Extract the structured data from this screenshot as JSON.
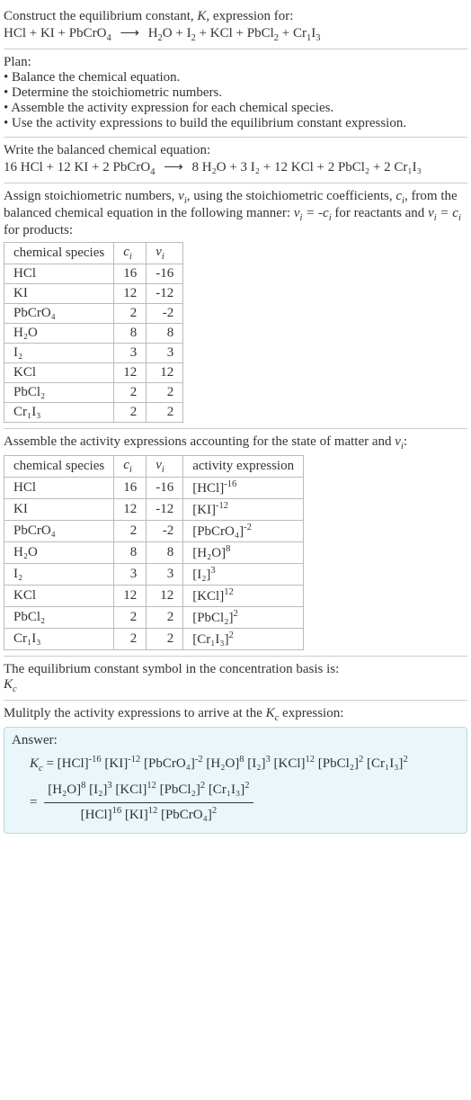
{
  "intro": {
    "line1_pre": "Construct the equilibrium constant, ",
    "line1_K": "K",
    "line1_post": ", expression for:",
    "eq_lhs": "HCl + KI + PbCrO",
    "eq_lhs_sub": "4",
    "arrow": "⟶",
    "eq_rhs_parts": [
      "H",
      "2",
      "O + I",
      "2",
      " + KCl + PbCl",
      "2",
      " + Cr",
      "1",
      "I",
      "3"
    ]
  },
  "plan": {
    "title": "Plan:",
    "items": [
      "Balance the chemical equation.",
      "Determine the stoichiometric numbers.",
      "Assemble the activity expression for each chemical species.",
      "Use the activity expressions to build the equilibrium constant expression."
    ]
  },
  "balanced": {
    "title": "Write the balanced chemical equation:",
    "lhs": "16 HCl + 12 KI + 2 PbCrO",
    "lhs_sub": "4",
    "arrow": "⟶",
    "rhs": "8 H₂O + 3 I₂ + 12 KCl + 2 PbCl₂ + 2 Cr₁I₃"
  },
  "assign": {
    "text_pre": "Assign stoichiometric numbers, ",
    "nu": "ν",
    "i": "i",
    "text_mid1": ", using the stoichiometric coefficients, ",
    "c": "c",
    "text_mid2": ", from the balanced chemical equation in the following manner: ",
    "rel1": "ν_i = -c_i",
    "text_mid3": " for reactants and ",
    "rel2": "ν_i = c_i",
    "text_end": " for products:"
  },
  "table1": {
    "headers": [
      "chemical species",
      "c_i",
      "ν_i"
    ],
    "rows": [
      [
        "HCl",
        "16",
        "-16"
      ],
      [
        "KI",
        "12",
        "-12"
      ],
      [
        "PbCrO₄",
        "2",
        "-2"
      ],
      [
        "H₂O",
        "8",
        "8"
      ],
      [
        "I₂",
        "3",
        "3"
      ],
      [
        "KCl",
        "12",
        "12"
      ],
      [
        "PbCl₂",
        "2",
        "2"
      ],
      [
        "Cr₁I₃",
        "2",
        "2"
      ]
    ]
  },
  "assemble_text": "Assemble the activity expressions accounting for the state of matter and ν_i:",
  "table2": {
    "headers": [
      "chemical species",
      "c_i",
      "ν_i",
      "activity expression"
    ],
    "rows": [
      {
        "sp": "HCl",
        "c": "16",
        "n": "-16",
        "ae_base": "[HCl]",
        "ae_exp": "-16"
      },
      {
        "sp": "KI",
        "c": "12",
        "n": "-12",
        "ae_base": "[KI]",
        "ae_exp": "-12"
      },
      {
        "sp": "PbCrO₄",
        "c": "2",
        "n": "-2",
        "ae_base": "[PbCrO₄]",
        "ae_exp": "-2"
      },
      {
        "sp": "H₂O",
        "c": "8",
        "n": "8",
        "ae_base": "[H₂O]",
        "ae_exp": "8"
      },
      {
        "sp": "I₂",
        "c": "3",
        "n": "3",
        "ae_base": "[I₂]",
        "ae_exp": "3"
      },
      {
        "sp": "KCl",
        "c": "12",
        "n": "12",
        "ae_base": "[KCl]",
        "ae_exp": "12"
      },
      {
        "sp": "PbCl₂",
        "c": "2",
        "n": "2",
        "ae_base": "[PbCl₂]",
        "ae_exp": "2"
      },
      {
        "sp": "Cr₁I₃",
        "c": "2",
        "n": "2",
        "ae_base": "[Cr₁I₃]",
        "ae_exp": "2"
      }
    ]
  },
  "symbol_text": "The equilibrium constant symbol in the concentration basis is:",
  "symbol": "K_c",
  "multiply_text": "Mulitply the activity expressions to arrive at the K_c expression:",
  "answer": {
    "label": "Answer:",
    "kc": "K_c",
    "line1_terms": [
      {
        "b": "[HCl]",
        "e": "-16"
      },
      {
        "b": "[KI]",
        "e": "-12"
      },
      {
        "b": "[PbCrO₄]",
        "e": "-2"
      },
      {
        "b": "[H₂O]",
        "e": "8"
      },
      {
        "b": "[I₂]",
        "e": "3"
      },
      {
        "b": "[KCl]",
        "e": "12"
      },
      {
        "b": "[PbCl₂]",
        "e": "2"
      },
      {
        "b": "[Cr₁I₃]",
        "e": "2"
      }
    ],
    "frac_num": [
      {
        "b": "[H₂O]",
        "e": "8"
      },
      {
        "b": "[I₂]",
        "e": "3"
      },
      {
        "b": "[KCl]",
        "e": "12"
      },
      {
        "b": "[PbCl₂]",
        "e": "2"
      },
      {
        "b": "[Cr₁I₃]",
        "e": "2"
      }
    ],
    "frac_den": [
      {
        "b": "[HCl]",
        "e": "16"
      },
      {
        "b": "[KI]",
        "e": "12"
      },
      {
        "b": "[PbCrO₄]",
        "e": "2"
      }
    ]
  },
  "chart_data": {
    "type": "table",
    "title": "Stoichiometric numbers and activity expressions",
    "columns": [
      "chemical species",
      "c_i",
      "ν_i",
      "activity expression"
    ],
    "rows": [
      [
        "HCl",
        16,
        -16,
        "[HCl]^-16"
      ],
      [
        "KI",
        12,
        -12,
        "[KI]^-12"
      ],
      [
        "PbCrO4",
        2,
        -2,
        "[PbCrO4]^-2"
      ],
      [
        "H2O",
        8,
        8,
        "[H2O]^8"
      ],
      [
        "I2",
        3,
        3,
        "[I2]^3"
      ],
      [
        "KCl",
        12,
        12,
        "[KCl]^12"
      ],
      [
        "PbCl2",
        2,
        2,
        "[PbCl2]^2"
      ],
      [
        "Cr1I3",
        2,
        2,
        "[Cr1I3]^2"
      ]
    ]
  }
}
